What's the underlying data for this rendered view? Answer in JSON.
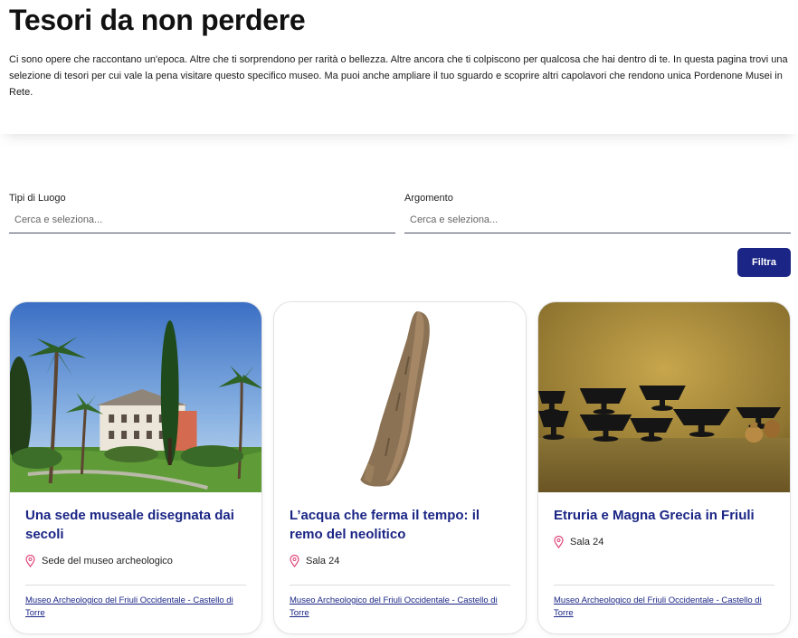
{
  "header": {
    "title": "Tesori da non perdere",
    "intro": "Ci sono opere che raccontano un'epoca. Altre che ti sorprendono per rarità o bellezza. Altre ancora che ti colpiscono per qualcosa che hai dentro di te. In questa pagina trovi una selezione di tesori per cui vale la pena visitare questo specifico museo. Ma puoi anche ampliare il tuo sguardo e scoprire altri capolavori che rendono unica Pordenone Musei in Rete."
  },
  "filters": {
    "place_type": {
      "label": "Tipi di Luogo",
      "placeholder": "Cerca e seleziona..."
    },
    "topic": {
      "label": "Argomento",
      "placeholder": "Cerca e seleziona..."
    },
    "submit_label": "Filtra"
  },
  "cards": [
    {
      "title": "Una sede museale disegnata dai secoli",
      "location": "Sede del museo archeologico",
      "museum_link": "Museo Archeologico del Friuli Occidentale - Castello di Torre",
      "image": "villa-with-palm-trees"
    },
    {
      "title": "L’acqua che ferma il tempo: il remo del neolitico",
      "location": "Sala 24",
      "museum_link": "Museo Archeologico del Friuli Occidentale - Castello di Torre",
      "image": "neolithic-wooden-oar"
    },
    {
      "title": "Etruria e Magna Grecia in Friuli",
      "location": "Sala 24",
      "museum_link": "Museo Archeologico del Friuli Occidentale - Castello di Torre",
      "image": "black-ceramic-bowls"
    }
  ],
  "colors": {
    "accent": "#1a2585",
    "pin": "#e0457b"
  }
}
